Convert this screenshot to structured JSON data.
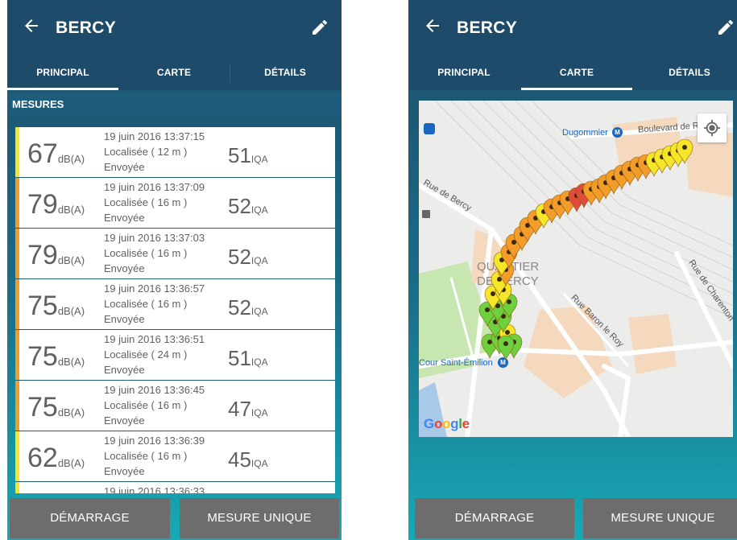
{
  "left_screen": {
    "title": "BERCY",
    "tabs": [
      "PRINCIPAL",
      "CARTE",
      "DÉTAILS"
    ],
    "active_tab": "PRINCIPAL",
    "section_title": "MESURES",
    "measurements": [
      {
        "db": "67",
        "db_unit": "dB(A)",
        "datetime": "19 juin 2016 13:37:15",
        "location": "Localisée ( 12 m )",
        "status": "Envoyée",
        "iqa": "51",
        "iqa_unit": "IQA",
        "color": "#f5e629"
      },
      {
        "db": "79",
        "db_unit": "dB(A)",
        "datetime": "19 juin 2016 13:37:09",
        "location": "Localisée ( 16 m )",
        "status": "Envoyée",
        "iqa": "52",
        "iqa_unit": "IQA",
        "color": "#f39c2a"
      },
      {
        "db": "79",
        "db_unit": "dB(A)",
        "datetime": "19 juin 2016 13:37:03",
        "location": "Localisée ( 16 m )",
        "status": "Envoyée",
        "iqa": "52",
        "iqa_unit": "IQA",
        "color": "#f39c2a"
      },
      {
        "db": "75",
        "db_unit": "dB(A)",
        "datetime": "19 juin 2016 13:36:57",
        "location": "Localisée ( 16 m )",
        "status": "Envoyée",
        "iqa": "52",
        "iqa_unit": "IQA",
        "color": "#f39c2a"
      },
      {
        "db": "75",
        "db_unit": "dB(A)",
        "datetime": "19 juin 2016 13:36:51",
        "location": "Localisée ( 24 m )",
        "status": "Envoyée",
        "iqa": "51",
        "iqa_unit": "IQA",
        "color": "#f39c2a"
      },
      {
        "db": "75",
        "db_unit": "dB(A)",
        "datetime": "19 juin 2016 13:36:45",
        "location": "Localisée ( 16 m )",
        "status": "Envoyée",
        "iqa": "47",
        "iqa_unit": "IQA",
        "color": "#f39c2a"
      },
      {
        "db": "62",
        "db_unit": "dB(A)",
        "datetime": "19 juin 2016 13:36:39",
        "location": "Localisée ( 16 m )",
        "status": "Envoyée",
        "iqa": "45",
        "iqa_unit": "IQA",
        "color": "#f5e629"
      },
      {
        "db": "",
        "db_unit": "",
        "datetime": "19 juin 2016 13:36:33",
        "location": "",
        "status": "",
        "iqa": "",
        "iqa_unit": "",
        "color": "#f5e629"
      }
    ],
    "start_button": "DÉMARRAGE",
    "single_button": "MESURE UNIQUE"
  },
  "right_screen": {
    "title": "BERCY",
    "tabs": [
      "PRINCIPAL",
      "CARTE",
      "DÉTAILS"
    ],
    "active_tab": "CARTE",
    "map_labels": {
      "dugommier": "Dugommier",
      "metro": "M",
      "boulevard": "Boulevard de R",
      "rue_bercy": "Rue de Bercy",
      "quartier_1": "QUARTIER",
      "quartier_2": "DE BERCY",
      "baron": "Rue Baron le Roy",
      "charenton": "Rue de Charenton",
      "cour": "Cour Saint-Émilion",
      "google": "Google"
    },
    "start_button": "DÉMARRAGE",
    "single_button": "MESURE UNIQUE"
  },
  "colors": {
    "header": "#1d4b69",
    "yellow": "#f5e629",
    "orange": "#f39c2a",
    "red": "#e04b3a",
    "green": "#6fd03d",
    "button": "#6d6d6d"
  },
  "icons": {
    "back": "back-arrow-icon",
    "edit": "pencil-icon",
    "locate": "my-location-icon"
  }
}
